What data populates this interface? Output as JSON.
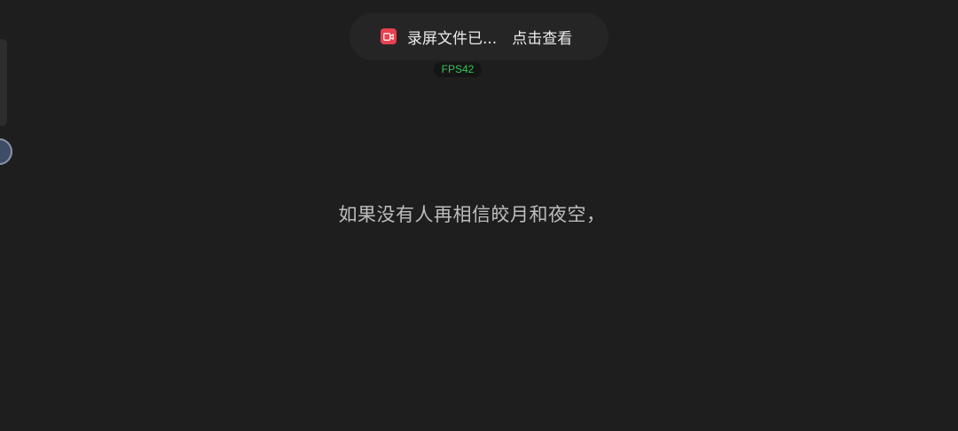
{
  "toast": {
    "icon": "screen-record-icon",
    "message": "录屏文件已...",
    "action": "点击查看",
    "accent": "#e8414f"
  },
  "overlay": {
    "fps_label": "FPS42",
    "fps_color": "#35c65a"
  },
  "lyric": {
    "line": "如果没有人再相信皎月和夜空，"
  }
}
